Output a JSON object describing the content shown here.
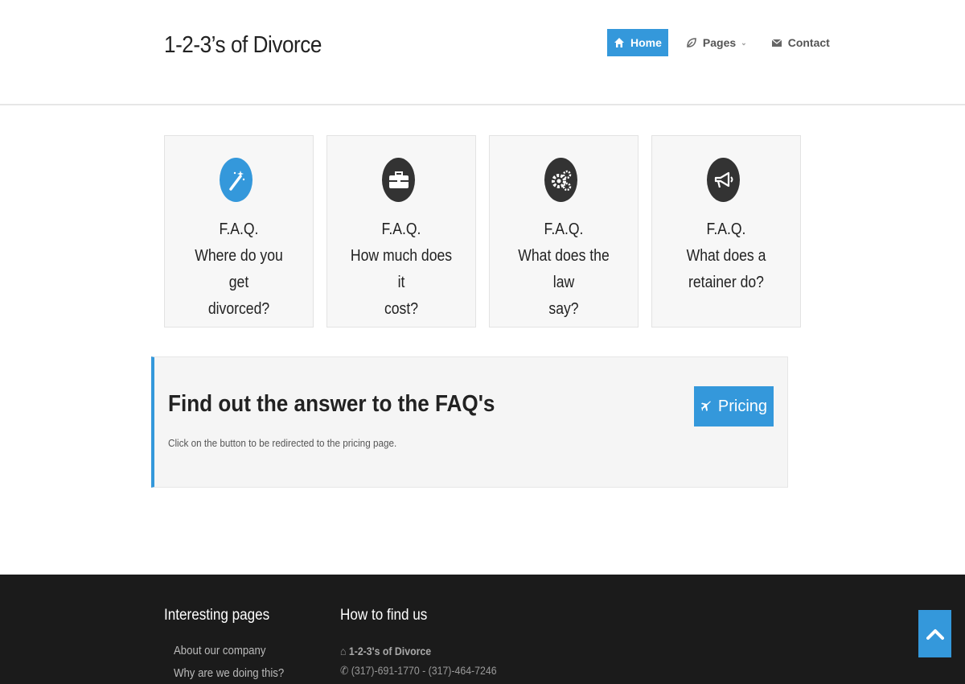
{
  "header": {
    "brand": "1-2-3’s of Divorce",
    "nav": [
      {
        "label": "Home",
        "icon": "home-icon",
        "active": true
      },
      {
        "label": "Pages",
        "icon": "leaf-icon",
        "active": false
      },
      {
        "label": "Contact",
        "icon": "envelope-icon",
        "active": false
      }
    ]
  },
  "features": [
    {
      "icon": "magic-wand-icon",
      "heading": "F.A.Q.",
      "line1": "Where do you get",
      "line2": "divorced?"
    },
    {
      "icon": "briefcase-icon",
      "heading": "F.A.Q.",
      "line1": "How much does it",
      "line2": "cost?"
    },
    {
      "icon": "gears-icon",
      "heading": "F.A.Q.",
      "line1": "What does the law",
      "line2": "say?"
    },
    {
      "icon": "megaphone-icon",
      "heading": "F.A.Q.",
      "line1": "What does a",
      "line2": "retainer do?"
    }
  ],
  "callout": {
    "title": "Find out the answer to the FAQ's",
    "text": "Click on the button to be redirected to the pricing page.",
    "button": "Pricing"
  },
  "footer": {
    "col1_title": "Interesting pages",
    "links": [
      "About our company",
      "Why are we doing this?"
    ],
    "col2_title": "How to find us",
    "company": "1-2-3's of Divorce",
    "phone": "(317)-691-1770 - (317)-464-7246"
  },
  "colors": {
    "accent": "#3498db",
    "footer_bg": "#1b1b1b"
  }
}
